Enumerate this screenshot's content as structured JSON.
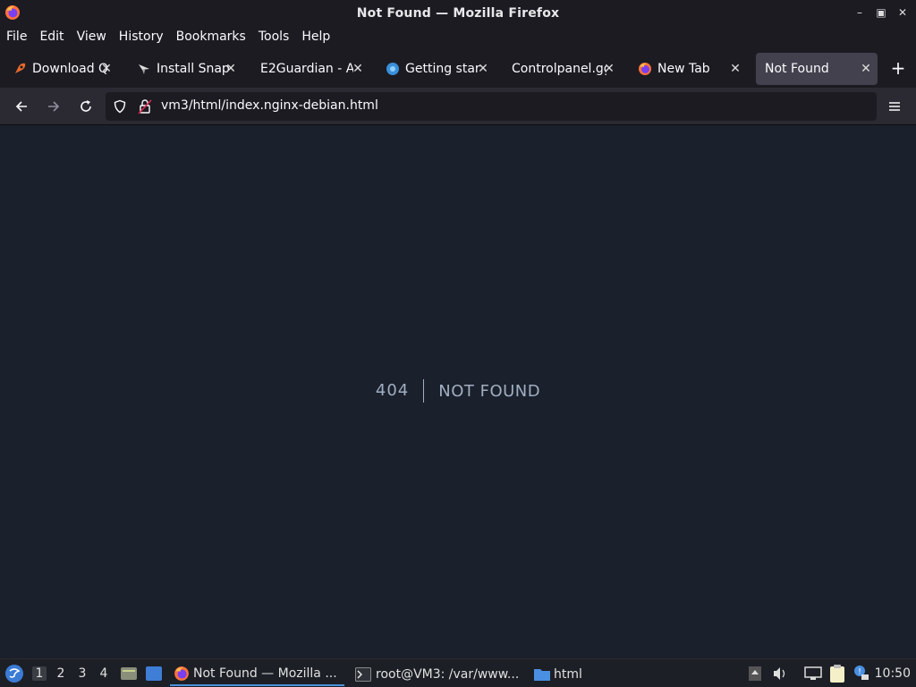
{
  "window": {
    "title": "Not Found — Mozilla Firefox"
  },
  "menubar": [
    "File",
    "Edit",
    "View",
    "History",
    "Bookmarks",
    "Tools",
    "Help"
  ],
  "tabs": [
    {
      "label": "Download Q",
      "icon": "rocket-icon"
    },
    {
      "label": "Install Snap",
      "icon": "snap-icon"
    },
    {
      "label": "E2Guardian - A",
      "icon": ""
    },
    {
      "label": "Getting start",
      "icon": "globe-icon"
    },
    {
      "label": "Controlpanel.gg",
      "icon": ""
    },
    {
      "label": "New Tab",
      "icon": "firefox-icon"
    },
    {
      "label": "Not Found",
      "icon": "",
      "active": true
    }
  ],
  "urlbar": {
    "url": "vm3/html/index.nginx-debian.html"
  },
  "page": {
    "code": "404",
    "message": "NOT FOUND"
  },
  "taskbar": {
    "workspaces": [
      "1",
      "2",
      "3",
      "4"
    ],
    "tasks": [
      {
        "label": "Not Found — Mozilla ...",
        "icon": "firefox-icon"
      },
      {
        "label": "root@VM3: /var/www...",
        "icon": "terminal-icon"
      },
      {
        "label": "html",
        "icon": "folder-icon"
      }
    ],
    "clock": "10:50"
  },
  "colors": {
    "content_bg": "#1a202c",
    "tab_active": "#42414d",
    "text_muted": "#a0aec0"
  }
}
